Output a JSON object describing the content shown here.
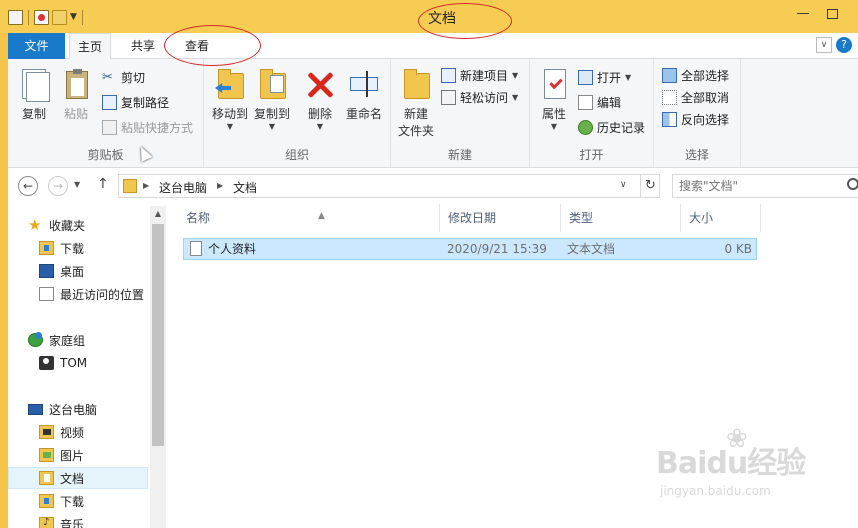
{
  "window": {
    "title": "文档"
  },
  "tabs": [
    {
      "label": "文件"
    },
    {
      "label": "主页"
    },
    {
      "label": "共享"
    },
    {
      "label": "查看"
    }
  ],
  "ribbon": {
    "clipboard": {
      "copy": "复制",
      "paste": "粘贴",
      "cut": "剪切",
      "copy_path": "复制路径",
      "paste_shortcut": "粘贴快捷方式",
      "group": "剪贴板"
    },
    "organize": {
      "move_to": "移动到",
      "copy_to": "复制到",
      "delete": "删除",
      "rename": "重命名",
      "group": "组织"
    },
    "new": {
      "new_folder_line1": "新建",
      "new_folder_line2": "文件夹",
      "new_item": "新建项目",
      "easy_access": "轻松访问",
      "group": "新建"
    },
    "open": {
      "properties": "属性",
      "open": "打开",
      "edit": "编辑",
      "history": "历史记录",
      "group": "打开"
    },
    "select": {
      "select_all": "全部选择",
      "select_none": "全部取消",
      "invert": "反向选择",
      "group": "选择"
    }
  },
  "address": {
    "crumbs": [
      "这台电脑",
      "文档"
    ],
    "search_placeholder": "搜索\"文档\""
  },
  "sidebar": {
    "favorites": "收藏夹",
    "downloads": "下载",
    "desktop": "桌面",
    "recent": "最近访问的位置",
    "homegroup": "家庭组",
    "user": "TOM",
    "this_pc": "这台电脑",
    "videos": "视频",
    "pictures": "图片",
    "documents": "文档",
    "downloads2": "下载",
    "music": "音乐"
  },
  "columns": {
    "name": "名称",
    "date": "修改日期",
    "type": "类型",
    "size": "大小"
  },
  "files": [
    {
      "name": "个人资料",
      "date": "2020/9/21 15:39",
      "type": "文本文档",
      "size": "0 KB"
    }
  ],
  "watermark": {
    "brand": "Baidu经验",
    "url": "jingyan.baidu.com"
  },
  "icons": {
    "accent": "#1979ca",
    "titlebar": "#f7cc52",
    "selection": "#cce8ff",
    "annotation": "#d42a2a"
  }
}
